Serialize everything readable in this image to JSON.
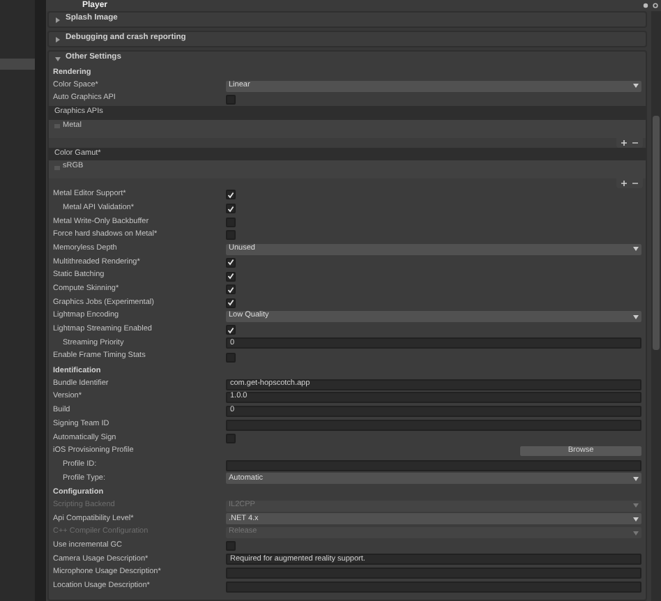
{
  "title": "Player",
  "sections": [
    {
      "label": "Splash Image",
      "expanded": false
    },
    {
      "label": "Debugging and crash reporting",
      "expanded": false
    },
    {
      "label": "Other Settings",
      "expanded": true,
      "rows": [
        {
          "kind": "header",
          "label": "Rendering"
        },
        {
          "kind": "dropdown",
          "label": "Color Space*",
          "value": "Linear",
          "disabled": false
        },
        {
          "kind": "checkbox",
          "label": "Auto Graphics API",
          "checked": false
        },
        {
          "kind": "list",
          "label": "Graphics APIs",
          "items": [
            "Metal"
          ]
        },
        {
          "kind": "list",
          "label": "Color Gamut*",
          "items": [
            "sRGB"
          ]
        },
        {
          "kind": "checkbox",
          "label": "Metal Editor Support*",
          "checked": true,
          "children": [
            {
              "kind": "checkbox",
              "label": "Metal API Validation*",
              "checked": true
            }
          ]
        },
        {
          "kind": "checkbox",
          "label": "Metal Write-Only Backbuffer",
          "checked": false
        },
        {
          "kind": "checkbox",
          "label": "Force hard shadows on Metal*",
          "checked": false
        },
        {
          "kind": "dropdown",
          "label": "Memoryless Depth",
          "value": "Unused",
          "disabled": false
        },
        {
          "kind": "checkbox",
          "label": "Multithreaded Rendering*",
          "checked": true
        },
        {
          "kind": "checkbox",
          "label": "Static Batching",
          "checked": true
        },
        {
          "kind": "checkbox",
          "label": "Compute Skinning*",
          "checked": true
        },
        {
          "kind": "checkbox",
          "label": "Graphics Jobs (Experimental)",
          "checked": true
        },
        {
          "kind": "dropdown",
          "label": "Lightmap Encoding",
          "value": "Low Quality",
          "disabled": false
        },
        {
          "kind": "checkbox",
          "label": "Lightmap Streaming Enabled",
          "checked": true,
          "children": [
            {
              "kind": "text",
              "label": "Streaming Priority",
              "value": "0"
            }
          ]
        },
        {
          "kind": "checkbox",
          "label": "Enable Frame Timing Stats",
          "checked": false
        },
        {
          "kind": "header",
          "label": "Identification"
        },
        {
          "kind": "text",
          "label": "Bundle Identifier",
          "value": "com.get-hopscotch.app"
        },
        {
          "kind": "text",
          "label": "Version*",
          "value": "1.0.0"
        },
        {
          "kind": "text",
          "label": "Build",
          "value": "0"
        },
        {
          "kind": "text",
          "label": "Signing Team ID"
        },
        {
          "kind": "checkbox",
          "label": "Automatically Sign",
          "checked": false
        },
        {
          "kind": "button",
          "label": "iOS Provisioning Profile",
          "button": "Browse",
          "children": [
            {
              "kind": "text",
              "label": "Profile ID:"
            },
            {
              "kind": "dropdown",
              "label": "Profile Type:",
              "value": "Automatic",
              "disabled": false
            }
          ]
        },
        {
          "kind": "header",
          "label": "Configuration"
        },
        {
          "kind": "dropdown",
          "label": "Scripting Backend",
          "value": "IL2CPP",
          "disabled": true
        },
        {
          "kind": "dropdown",
          "label": "Api Compatibility Level*",
          "value": ".NET 4.x",
          "disabled": false
        },
        {
          "kind": "dropdown",
          "label": "C++ Compiler Configuration",
          "value": "Release",
          "disabled": true
        },
        {
          "kind": "checkbox",
          "label": "Use incremental GC",
          "checked": false
        },
        {
          "kind": "text",
          "label": "Camera Usage Description*",
          "value": "Required for augmented reality support."
        },
        {
          "kind": "text",
          "label": "Microphone Usage Description*"
        },
        {
          "kind": "text",
          "label": "Location Usage Description*"
        }
      ]
    }
  ]
}
